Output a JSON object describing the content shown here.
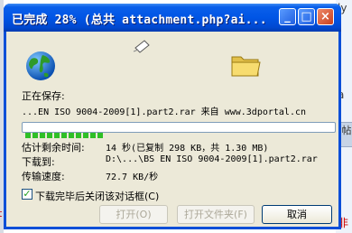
{
  "window": {
    "title": "已完成 28% (总共 attachment.php?ai...",
    "min_label": "_",
    "max_label": "□",
    "close_label": "×"
  },
  "saving": {
    "label": "正在保存:",
    "filename": "...EN ISO 9004-2009[1].part2.rar 来自 www.3dportal.cn"
  },
  "progress": {
    "percent": 28
  },
  "info": {
    "time_label": "估计剩余时间:",
    "time_value": "14 秒(已复制 298 KB，共 1.30 MB)",
    "dest_label": "下载到:",
    "dest_value": "D:\\...\\BS EN ISO 9004-2009[1].part2.rar",
    "rate_label": "传输速度:",
    "rate_value": "72.7 KB/秒"
  },
  "close_when_done": {
    "label": "下载完毕后关闭该对话框(C)",
    "checked": true
  },
  "buttons": {
    "open": "打开(O)",
    "open_folder": "打开文件夹(F)",
    "cancel": "取消"
  },
  "background": {
    "left_fragment": "t",
    "right_top": "ly",
    "right_mid": "a",
    "right_tab": "帖",
    "right_bottom": "非"
  }
}
